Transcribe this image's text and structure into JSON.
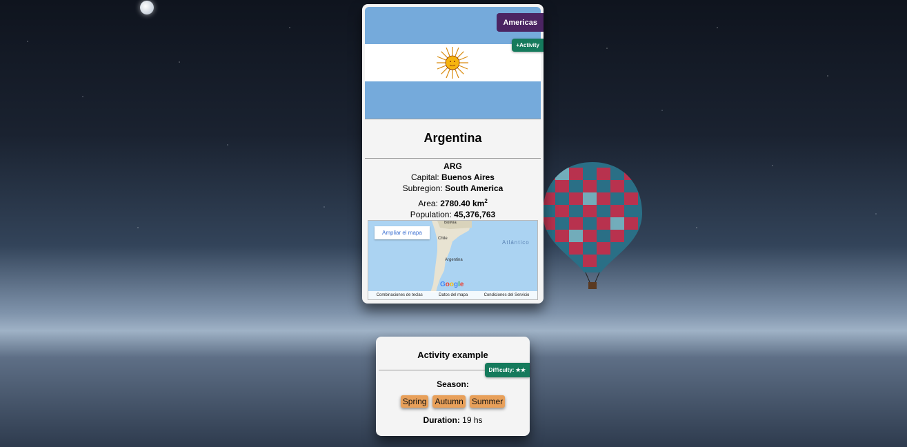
{
  "country": {
    "region": "Americas",
    "activity_button": "+Activity",
    "name": "Argentina",
    "code": "ARG",
    "capital_label": "Capital:",
    "capital": "Buenos Aires",
    "subregion_label": "Subregion:",
    "subregion": "South America",
    "area_label": "Area:",
    "area": "2780.40 km",
    "area_unit_sup": "2",
    "population_label": "Population:",
    "population": "45,376,763",
    "flag_colors": {
      "blue": "#75aadb",
      "white": "#ffffff",
      "sun": "#f6b40e"
    }
  },
  "map": {
    "expand_button": "Ampliar el mapa",
    "labels": {
      "bolivia": "Bolivia",
      "chile": "Chile",
      "argentina": "Argentina",
      "ocean": "Atlántico"
    },
    "logo": "Google",
    "footer": [
      "Combinaciones de teclas",
      "Datos del mapa",
      "Condiciones del Servicio"
    ]
  },
  "activity": {
    "title": "Activity example",
    "difficulty": "Difficulty: ★★",
    "season_label": "Season:",
    "seasons": [
      "Spring",
      "Autumn",
      "Summer"
    ],
    "duration_label": "Duration:",
    "duration": "19 hs"
  },
  "colors": {
    "region_badge": "#4b2462",
    "activity_badge": "#157a5c",
    "season_chip": "#e8a05a"
  }
}
